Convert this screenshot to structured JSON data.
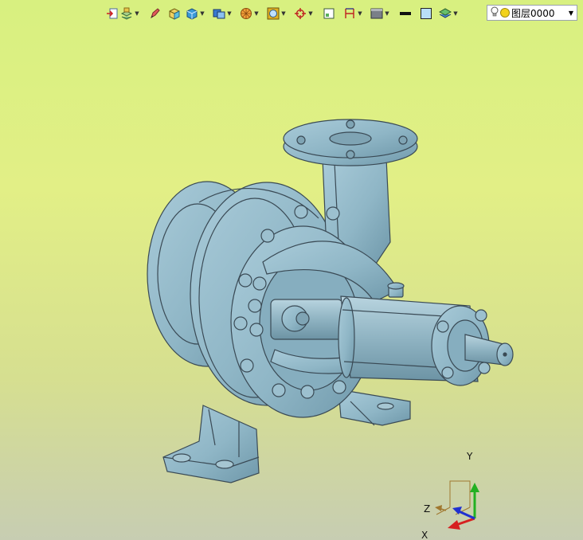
{
  "toolbar": {
    "buttons": [
      {
        "name": "import-icon"
      },
      {
        "name": "layers-stack-icon",
        "dropdown": true
      },
      {
        "name": "pencil-icon"
      },
      {
        "name": "cube-box-icon"
      },
      {
        "name": "cube-solid-icon",
        "dropdown": true
      },
      {
        "name": "view-cube-icon",
        "dropdown": true
      },
      {
        "name": "render-sphere-icon",
        "dropdown": true
      },
      {
        "name": "frame-icon",
        "dropdown": true
      },
      {
        "name": "crosshair-icon",
        "dropdown": true
      },
      {
        "name": "window-grid-icon"
      },
      {
        "name": "dimension-icon",
        "dropdown": true
      },
      {
        "name": "display-mode-icon",
        "dropdown": true
      },
      {
        "name": "line-color-icon"
      },
      {
        "name": "fill-color-icon"
      },
      {
        "name": "layer-stack-icon",
        "dropdown": true
      }
    ],
    "arrow_glyph": "▼"
  },
  "layer_selector": {
    "value": "图层0000",
    "bulb_icon": "lightbulb-icon",
    "color": "#f2d21a"
  },
  "axis_triad": {
    "x_label": "X",
    "y_label": "Y",
    "z_label": "Z",
    "x_color": "#d62020",
    "y_color": "#22b022",
    "z_color": "#2030d0"
  },
  "model": {
    "name": "centrifugal-pump",
    "body_color": "#8fb6c6",
    "edge_color": "#3a4a55"
  }
}
